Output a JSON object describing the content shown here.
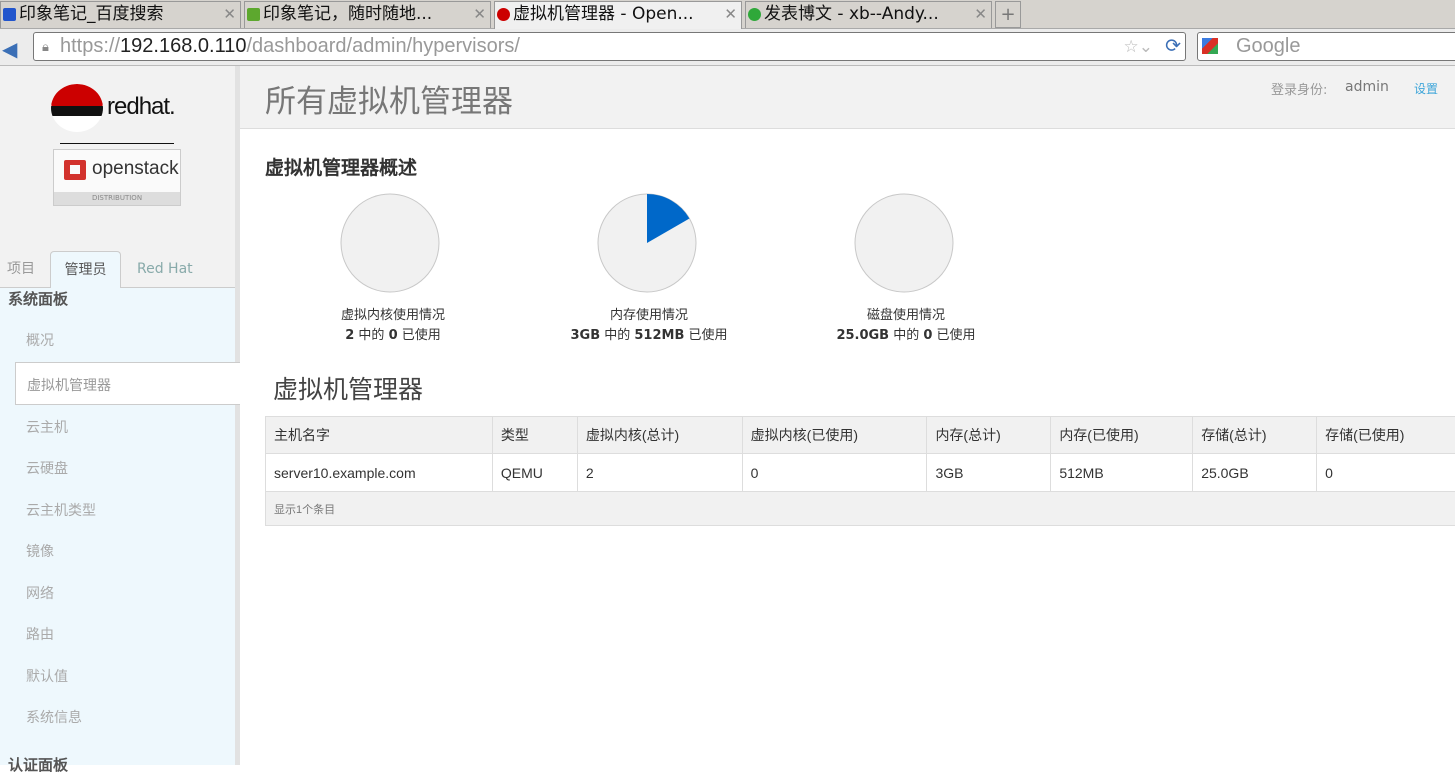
{
  "browser": {
    "tabs": [
      {
        "title": "印象笔记_百度搜索",
        "icon": "paw-icon",
        "color": "#2255cc"
      },
      {
        "title": "印象笔记，随时随地...",
        "icon": "evernote-icon",
        "color": "#5da82e"
      },
      {
        "title": "虚拟机管理器 - Open...",
        "icon": "redhat-icon",
        "color": "#cc0000",
        "active": true
      },
      {
        "title": "发表博文 - xb--Andy...",
        "icon": "c-icon",
        "color": "#2fa83a"
      }
    ],
    "url_prefix": "https://",
    "url_host": "192.168.0.110",
    "url_path": "/dashboard/admin/hypervisors/",
    "search_placeholder": "Google"
  },
  "brand": {
    "redhat": "redhat.",
    "openstack": "openstack",
    "distribution": "DISTRIBUTION"
  },
  "sidebar": {
    "tabs": [
      "项目",
      "管理员",
      "Red Hat"
    ],
    "heading": "系统面板",
    "items": [
      "概况",
      "虚拟机管理器",
      "云主机",
      "云硬盘",
      "云主机类型",
      "镜像",
      "网络",
      "路由",
      "默认值",
      "系统信息"
    ],
    "selected": "虚拟机管理器",
    "next_heading": "认证面板"
  },
  "header": {
    "title": "所有虚拟机管理器",
    "login_label": "登录身份:",
    "user": "admin",
    "settings": "设置"
  },
  "overview": {
    "title": "虚拟机管理器概述",
    "charts": [
      {
        "label": "虚拟内核使用情况",
        "total": "2",
        "used": "0",
        "mid": " 中的 ",
        "suffix": " 已使用",
        "fraction": 0
      },
      {
        "label": "内存使用情况",
        "total": "3GB",
        "used": "512MB",
        "mid": " 中的 ",
        "suffix": " 已使用",
        "fraction": 0.1667
      },
      {
        "label": "磁盘使用情况",
        "total": "25.0GB",
        "used": "0",
        "mid": " 中的 ",
        "suffix": " 已使用",
        "fraction": 0
      }
    ],
    "colors": {
      "used": "#0068c9",
      "free": "#f1f1f1",
      "border": "#c8c8c8"
    }
  },
  "table": {
    "title": "虚拟机管理器",
    "columns": [
      "主机名字",
      "类型",
      "虚拟内核(总计)",
      "虚拟内核(已使用)",
      "内存(总计)",
      "内存(已使用)",
      "存储(总计)",
      "存储(已使用)"
    ],
    "rows": [
      [
        "server10.example.com",
        "QEMU",
        "2",
        "0",
        "3GB",
        "512MB",
        "25.0GB",
        "0"
      ]
    ],
    "footer": "显示1个条目"
  }
}
